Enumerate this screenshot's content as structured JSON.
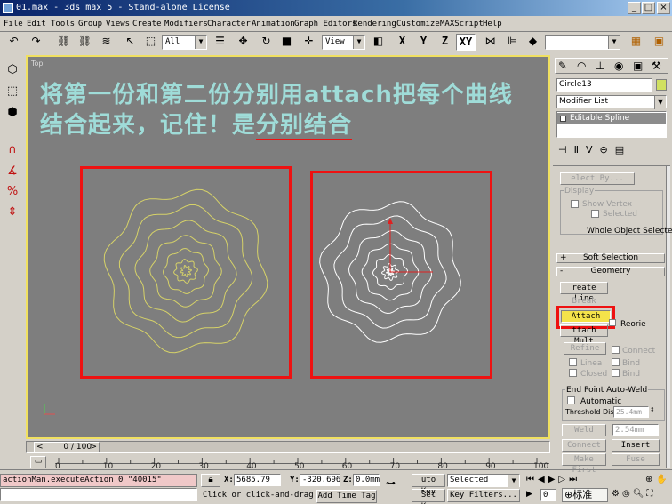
{
  "window": {
    "title": "01.max - 3ds max 5 - Stand-alone License",
    "min": "_",
    "max": "□",
    "close": "×"
  },
  "menu": [
    "File",
    "Edit",
    "Tools",
    "Group",
    "Views",
    "Create",
    "Modifiers",
    "Character",
    "Animation",
    "Graph Editors",
    "Rendering",
    "Customize",
    "MAXScript",
    "Help"
  ],
  "toolbar": {
    "selection_filter": "All",
    "ref_coord": "View",
    "axes": [
      "X",
      "Y",
      "Z",
      "XY"
    ],
    "named_selection": ""
  },
  "viewport": {
    "label": "Top",
    "caption_line1": "将第一份和第二份分别用attach把每个曲线",
    "caption_line2_a": "结合起来，记住！是",
    "caption_line2_b": "分别结合",
    "yellow_color": "#d6d268",
    "white_color": "#ffffff",
    "box_color": "#e11111"
  },
  "panel": {
    "object_name": "Circle13",
    "modifier_list": "Modifier List",
    "stack_item": "Editable Spline",
    "select_by": "elect By...",
    "display_group": "Display",
    "show_vertex": "Show Vertex",
    "selected": "Selected",
    "whole_object": "Whole Object Selected",
    "soft_selection": "Soft Selection",
    "geometry": "Geometry",
    "create_line": "reate Line",
    "break": "Break",
    "attach": "Attach",
    "reorient": "Reorie",
    "attach_mult": "ttach Mult",
    "refine": "Refine",
    "connect": "Connect",
    "linear": "Linea",
    "bind1": "Bind",
    "closed": "Closed",
    "bind2": "Bind",
    "endpoint_weld": "End Point Auto-Weld",
    "automatic": "Automatic",
    "threshold_label": "Threshold Dist",
    "threshold_value": "25.4mm",
    "weld": "Weld",
    "weld_value": "2.54mm",
    "connect_btn": "Connect",
    "insert": "Insert",
    "make_first": "Make First",
    "fuse": "Fuse"
  },
  "timeline": {
    "frame": "0 / 100",
    "ticks": [
      "0",
      "10",
      "20",
      "30",
      "40",
      "50",
      "60",
      "70",
      "80",
      "90",
      "100"
    ]
  },
  "status": {
    "maxscript": "actionMan.executeAction 0 \"40015\"",
    "x_label": "X:",
    "x_value": "5685.79",
    "y_label": "Y:",
    "y_value": "-320.696",
    "z_label": "Z:",
    "z_value": "0.0mm",
    "auto_key": "uto Key",
    "selected": "Selected",
    "set_key": "Set Key",
    "key_filters": "Key Filters...",
    "prompt": "Click or click-and-drag",
    "add_time_tag": "Add Time Tag",
    "frame_field": "0",
    "ime": "标准"
  }
}
